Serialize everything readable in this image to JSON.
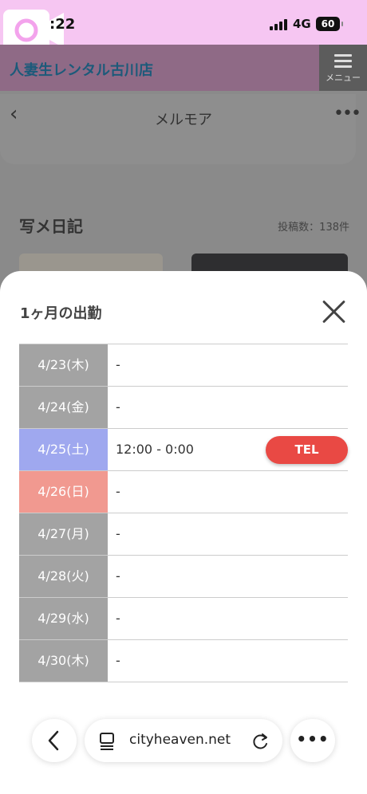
{
  "status_bar": {
    "time": ":22",
    "network": "4G",
    "battery": "60",
    "colors": {
      "background": "#f6c6f2"
    }
  },
  "background_page": {
    "site_title": "人妻生レンタル古川店",
    "menu_label": "メニュー",
    "nav_title": "メルモア",
    "diary_title": "写メ日記",
    "diary_count": "投稿数：138件"
  },
  "modal": {
    "title": "1ヶ月の出勤",
    "tel_label": "TEL",
    "schedule": [
      {
        "date": "4/23(木)",
        "hours": "-"
      },
      {
        "date": "4/24(金)",
        "hours": "-"
      },
      {
        "date": "4/25(土)",
        "hours": "12:00 - 0:00"
      },
      {
        "date": "4/26(日)",
        "hours": "-"
      },
      {
        "date": "4/27(月)",
        "hours": "-"
      },
      {
        "date": "4/28(火)",
        "hours": "-"
      },
      {
        "date": "4/29(水)",
        "hours": "-"
      },
      {
        "date": "4/30(木)",
        "hours": "-"
      }
    ],
    "colors": {
      "weekday": "#a3a3a3",
      "saturday": "#9fa8ef",
      "sunday": "#f19990",
      "tel": "#e94944"
    }
  },
  "browser": {
    "url": "cityheaven.net",
    "icons": [
      "back-icon",
      "tabs-icon",
      "reload-icon",
      "more-icon"
    ]
  }
}
